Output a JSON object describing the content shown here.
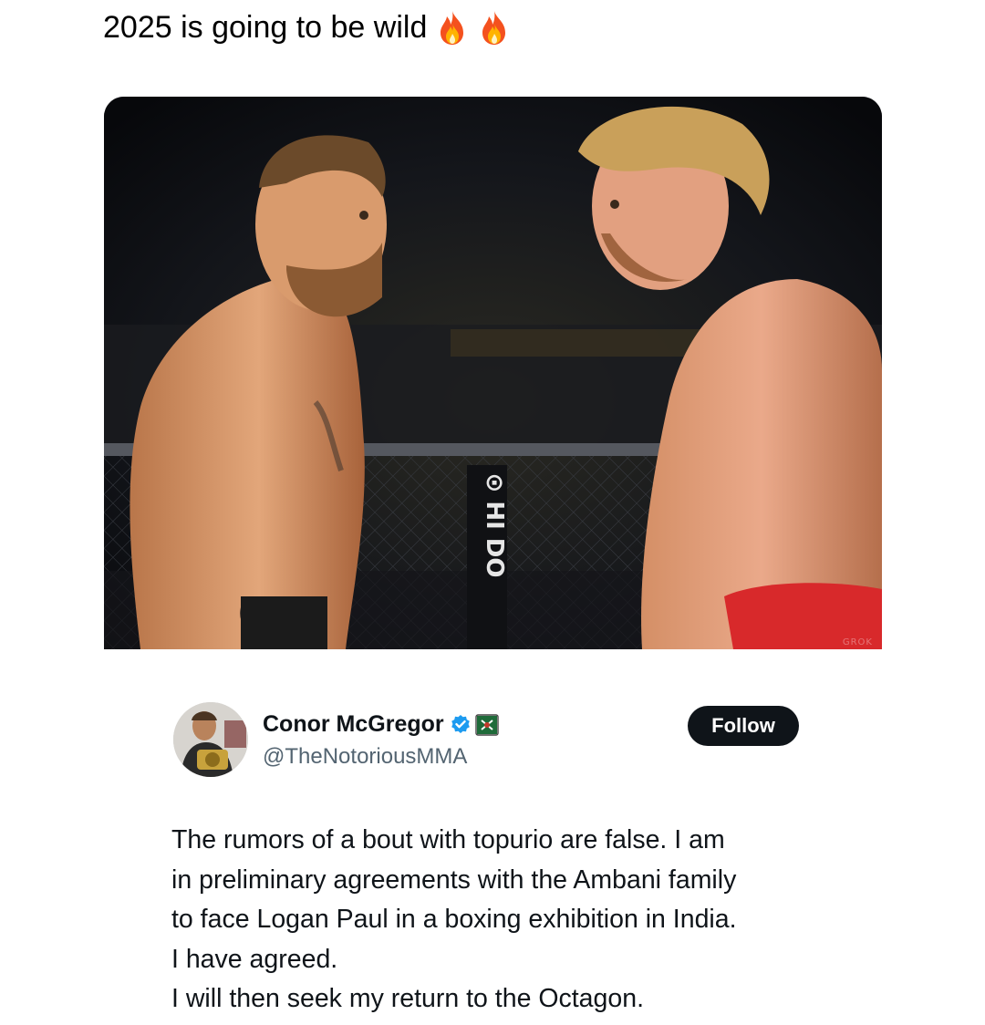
{
  "caption": {
    "text": "2025 is going to be wild",
    "emoji": [
      "fire-icon",
      "fire-icon"
    ]
  },
  "media": {
    "description_icon": "photo",
    "watermark": "GROK"
  },
  "tweet": {
    "author_name": "Conor McGregor",
    "verified_icon": "verified-badge-icon",
    "affiliate_icon": "flag-icon",
    "handle": "@TheNotoriousMMA",
    "follow_label": "Follow",
    "text_lines": [
      "The rumors of a bout with topurio are false. I am",
      "in preliminary agreements with the Ambani family",
      "to face Logan Paul in a boxing exhibition in India.",
      "I have agreed.",
      "I will then seek my return to the Octagon."
    ]
  },
  "colors": {
    "text_primary": "#0f1419",
    "text_secondary": "#536471",
    "verified_blue": "#1d9bf0",
    "follow_bg": "#0f1419",
    "follow_text": "#ffffff"
  }
}
